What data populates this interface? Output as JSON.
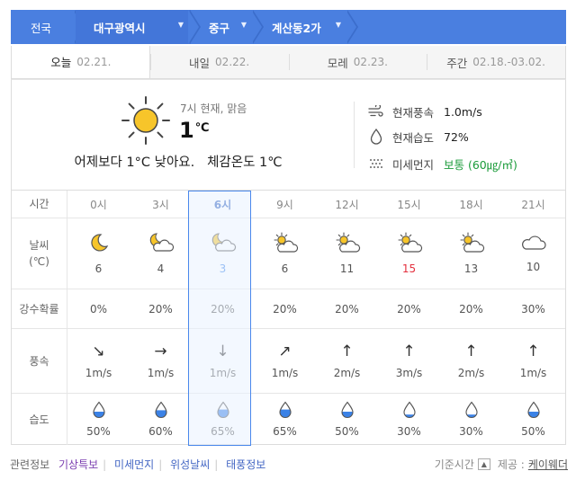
{
  "breadcrumb": [
    {
      "label": "전국",
      "dropdown": false
    },
    {
      "label": "대구광역시",
      "dropdown": true
    },
    {
      "label": "중구",
      "dropdown": true
    },
    {
      "label": "계산동2가",
      "dropdown": true
    }
  ],
  "tabs": [
    {
      "label": "오늘",
      "date": "02.21.",
      "active": true
    },
    {
      "label": "내일",
      "date": "02.22.",
      "active": false
    },
    {
      "label": "모레",
      "date": "02.23.",
      "active": false
    },
    {
      "label": "주간",
      "date": "02.18.-03.02.",
      "active": false
    }
  ],
  "current": {
    "label": "7시 현재, 맑음",
    "temp": "1",
    "temp_unit": "℃",
    "compare": "어제보다 1°C 낮아요.   체감온도 1℃",
    "wind_label": "현재풍속",
    "wind_value": "1.0m/s",
    "humidity_label": "현재습도",
    "humidity_value": "72%",
    "dust_label": "미세먼지",
    "dust_value": "보통 (60㎍/㎥)",
    "dust_color": "#1b9b3a"
  },
  "table": {
    "labels": {
      "time": "시간",
      "sky": "날씨\n(℃)",
      "pop": "강수확률",
      "wind": "풍속",
      "humidity": "습도"
    },
    "hours": [
      {
        "time": "0시",
        "icon": "moon-icon",
        "temp": "6",
        "pop": "0%",
        "wind_arrow": "↘",
        "wind": "1m/s",
        "humidity": "50%",
        "humidity_fill": 0.5
      },
      {
        "time": "3시",
        "icon": "moon-cloud-icon",
        "temp": "4",
        "pop": "20%",
        "wind_arrow": "→",
        "wind": "1m/s",
        "humidity": "60%",
        "humidity_fill": 0.6
      },
      {
        "time": "6시",
        "icon": "moon-cloud-icon",
        "temp": "3",
        "pop": "20%",
        "wind_arrow": "↓",
        "wind": "1m/s",
        "humidity": "65%",
        "humidity_fill": 0.65,
        "selected": true,
        "temp_color": "blue"
      },
      {
        "time": "9시",
        "icon": "sun-cloud-icon",
        "temp": "6",
        "pop": "20%",
        "wind_arrow": "↗",
        "wind": "1m/s",
        "humidity": "65%",
        "humidity_fill": 0.65
      },
      {
        "time": "12시",
        "icon": "sun-cloud-icon",
        "temp": "11",
        "pop": "20%",
        "wind_arrow": "↑",
        "wind": "2m/s",
        "humidity": "50%",
        "humidity_fill": 0.5
      },
      {
        "time": "15시",
        "icon": "sun-cloud-icon",
        "temp": "15",
        "pop": "20%",
        "wind_arrow": "↑",
        "wind": "3m/s",
        "humidity": "30%",
        "humidity_fill": 0.3,
        "temp_color": "red"
      },
      {
        "time": "18시",
        "icon": "sun-cloud-icon",
        "temp": "13",
        "pop": "20%",
        "wind_arrow": "↑",
        "wind": "2m/s",
        "humidity": "30%",
        "humidity_fill": 0.3
      },
      {
        "time": "21시",
        "icon": "cloud-icon",
        "temp": "10",
        "pop": "30%",
        "wind_arrow": "↑",
        "wind": "1m/s",
        "humidity": "50%",
        "humidity_fill": 0.5
      }
    ]
  },
  "footer": {
    "related_label": "관련정보",
    "links": [
      "기상특보",
      "미세먼지",
      "위성날씨",
      "태풍정보"
    ],
    "base_time_label": "기준시간",
    "provider_label": "제공 :",
    "provider": "케이웨더"
  }
}
